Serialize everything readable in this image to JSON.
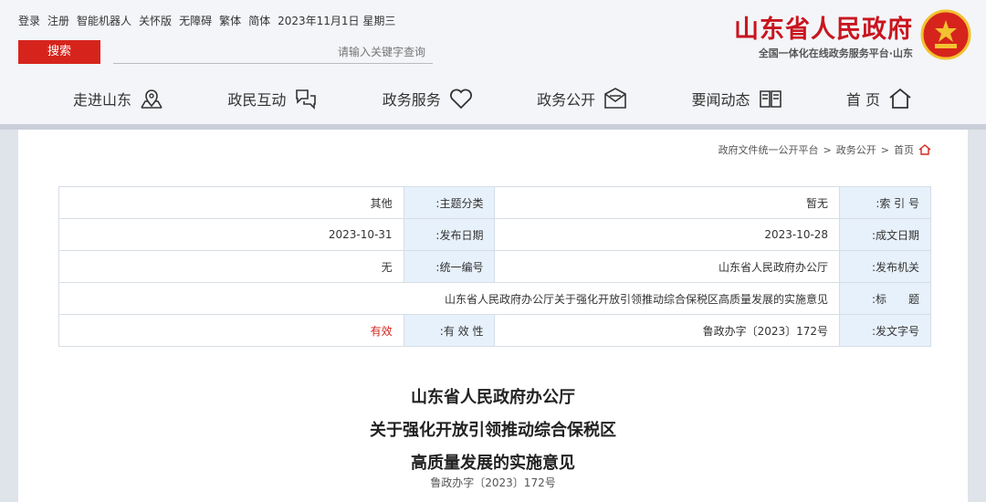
{
  "header": {
    "title": "山东省人民政府",
    "subtitle": "全国一体化在线政务服务平台·山东",
    "date_text": "2023年11月1日 星期三",
    "links": [
      "简体",
      "繁体",
      "无障碍",
      "关怀版",
      "智能机器人",
      "登录",
      "注册"
    ],
    "search_button": "搜索",
    "search_placeholder": "请输入关键字查询",
    "brand_color": "#c9151e"
  },
  "nav": [
    {
      "label": "首 页",
      "icon": "home-icon"
    },
    {
      "label": "要闻动态",
      "icon": "newspaper-icon"
    },
    {
      "label": "政务公开",
      "icon": "mail-icon"
    },
    {
      "label": "政务服务",
      "icon": "heart-icon"
    },
    {
      "label": "政民互动",
      "icon": "chat-icon"
    },
    {
      "label": "走进山东",
      "icon": "map-pin-icon"
    }
  ],
  "breadcrumb": [
    "首页",
    "政务公开",
    "政府文件统一公开平台"
  ],
  "meta": {
    "index_label": "索 引 号:",
    "index_value": "暂无",
    "category_label": "主题分类:",
    "category_value": "其他",
    "date_label": "成文日期:",
    "date_value": "2023-10-28",
    "pub_label": "发布日期:",
    "pub_value": "2023-10-31",
    "org_label": "发布机关:",
    "org_value": "山东省人民政府办公厅",
    "code_label": "统一编号:",
    "code_value": "无",
    "title_label": "标　　题:",
    "title_value": "山东省人民政府办公厅关于强化开放引领推动综合保税区高质量发展的实施意见",
    "docno_label": "发文字号:",
    "docno_value": "鲁政办字〔2023〕172号",
    "validity_label": "有 效 性:",
    "validity_value": "有效"
  },
  "document": {
    "title_lines": [
      "山东省人民政府办公厅",
      "关于强化开放引领推动综合保税区",
      "高质量发展的实施意见"
    ],
    "number": "鲁政办字〔2023〕172号"
  }
}
